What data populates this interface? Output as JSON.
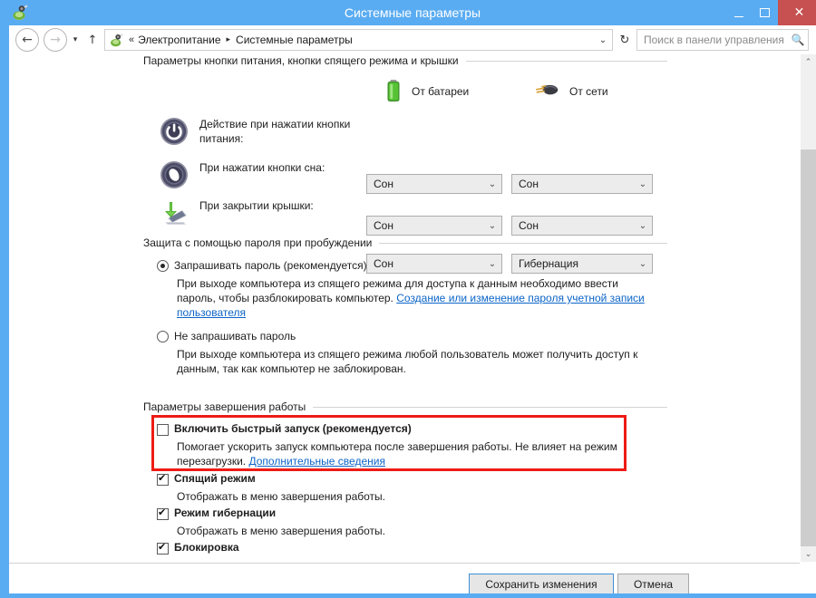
{
  "window": {
    "title": "Системные параметры",
    "icon": "power-options-icon",
    "buttons": {
      "minimize": "minimize-icon",
      "maximize": "maximize-icon",
      "close": "✕"
    },
    "close_color": "#c75050",
    "frame_color": "#5aacf2"
  },
  "address": {
    "back": "←",
    "forward": "→",
    "history_caret": "▾",
    "up": "↑",
    "crumb_icon": "power-options-icon",
    "double_chevron": "«",
    "crumb1": "Электропитание",
    "crumb_arrow": "▸",
    "crumb2": "Системные параметры",
    "dropdown_caret": "⌄",
    "refresh": "↻"
  },
  "search": {
    "placeholder": "Поиск в панели управления",
    "value": "",
    "icon": "search-icon"
  },
  "sections": {
    "power_buttons": {
      "heading": "Параметры кнопки питания, кнопки спящего режима и крышки",
      "columns": [
        {
          "label": "От батареи",
          "icon": "battery-icon"
        },
        {
          "label": "От сети",
          "icon": "plug-icon"
        }
      ],
      "rows": [
        {
          "icon": "power-button-icon",
          "label": "Действие при нажатии кнопки питания:",
          "battery": "Сон",
          "plugged": "Сон"
        },
        {
          "icon": "sleep-button-icon",
          "label": "При нажатии кнопки сна:",
          "battery": "Сон",
          "plugged": "Сон"
        },
        {
          "icon": "laptop-lid-icon",
          "label": "При закрытии крышки:",
          "battery": "Сон",
          "plugged": "Гибернация"
        }
      ]
    },
    "password_protection": {
      "heading": "Защита с помощью пароля при пробуждении",
      "options": [
        {
          "label": "Запрашивать пароль (рекомендуется)",
          "selected": true,
          "desc_line1": "При выходе компьютера из спящего режима для доступа к данным необходимо ввести",
          "desc_line2_pre": "пароль, чтобы разблокировать компьютер. ",
          "link": "Создание или изменение пароля учетной записи пользователя"
        },
        {
          "label": "Не запрашивать пароль",
          "selected": false,
          "desc_line1": "При выходе компьютера из спящего режима любой пользователь может получить доступ к",
          "desc_line2": "данным, так как компьютер не заблокирован."
        }
      ]
    },
    "shutdown_settings": {
      "heading": "Параметры завершения работы",
      "highlight_color": "#ee1b15",
      "items": [
        {
          "label": "Включить быстрый запуск (рекомендуется)",
          "checked": false,
          "highlighted": true,
          "desc_line1": "Помогает ускорить запуск компьютера после завершения работы. Не влияет на режим",
          "desc_line2_pre": "перезагрузки. ",
          "link": "Дополнительные сведения"
        },
        {
          "label": "Спящий режим",
          "checked": true,
          "highlighted": false,
          "desc_line1": "Отображать в меню завершения работы."
        },
        {
          "label": "Режим гибернации",
          "checked": true,
          "highlighted": false,
          "desc_line1": "Отображать в меню завершения работы."
        },
        {
          "label": "Блокировка",
          "checked": true,
          "highlighted": false
        }
      ]
    }
  },
  "footer": {
    "save_label": "Сохранить изменения",
    "cancel_label": "Отмена"
  },
  "scrollbar": {
    "up_arrow": "⌃",
    "down_arrow": "⌄"
  }
}
